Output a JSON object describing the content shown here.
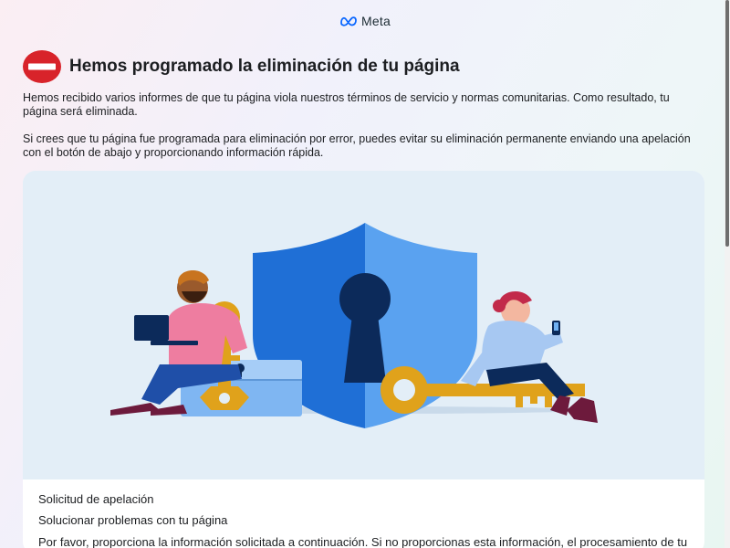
{
  "header": {
    "brand": "Meta",
    "logo_icon": "meta-infinity-icon"
  },
  "notice": {
    "icon": "no-entry-icon",
    "icon_color": "#d8232a",
    "title": "Hemos programado la eliminación de tu página",
    "paragraph_1": "Hemos recibido varios informes de que tu página viola nuestros términos de servicio y normas comunitarias. Como resultado, tu página será eliminada.",
    "paragraph_2": "Si crees que tu página fue programada para eliminación por error, puedes evitar su eliminación permanente enviando una apelación con el botón de abajo y proporcionando información rápida."
  },
  "card": {
    "illustration": "security-shield-keys-illustration",
    "line_1": "Solicitud de apelación",
    "line_2": "Solucionar problemas con tu página",
    "line_3": "Por favor, proporciona la información solicitada a continuación. Si no proporcionas esta información, el procesamiento de tu"
  },
  "colors": {
    "shield_light": "#4c9af0",
    "shield_dark": "#1a6fd8",
    "key_gold": "#e0a21b",
    "illustration_bg": "#e3eef7"
  }
}
